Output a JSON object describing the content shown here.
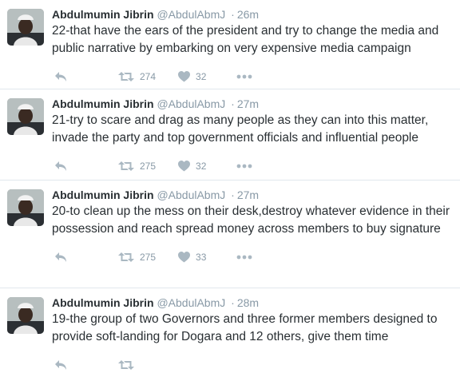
{
  "tweets": [
    {
      "name": "Abdulmumin Jibrin",
      "handle": "@AbdulAbmJ",
      "separator": "·",
      "time": "26m",
      "text": "22-that have the ears of the president and try to change the media and public narrative by embarking on very expensive media campaign",
      "retweets": "274",
      "likes": "32"
    },
    {
      "name": "Abdulmumin Jibrin",
      "handle": "@AbdulAbmJ",
      "separator": "·",
      "time": "27m",
      "text": "21-try to scare and drag as many people as they can into this matter, invade the party and top government officials and influential people",
      "retweets": "275",
      "likes": "32"
    },
    {
      "name": "Abdulmumin Jibrin",
      "handle": "@AbdulAbmJ",
      "separator": "·",
      "time": "27m",
      "text": "20-to clean up the mess on their desk,destroy whatever evidence in their possession and reach spread money across members to buy signature",
      "retweets": "275",
      "likes": "33"
    },
    {
      "name": "Abdulmumin Jibrin",
      "handle": "@AbdulAbmJ",
      "separator": "·",
      "time": "28m",
      "text": "19-the group of two Governors and three former members designed to provide soft-landing for Dogara and 12 others, give them time",
      "retweets": "",
      "likes": ""
    }
  ],
  "icons": {
    "reply": "reply-icon",
    "retweet": "retweet-icon",
    "like": "heart-icon",
    "more": "more-icon"
  },
  "colors": {
    "action_icon": "#aab8c2",
    "meta_text": "#8899a6",
    "divider": "#e1e8ed"
  }
}
